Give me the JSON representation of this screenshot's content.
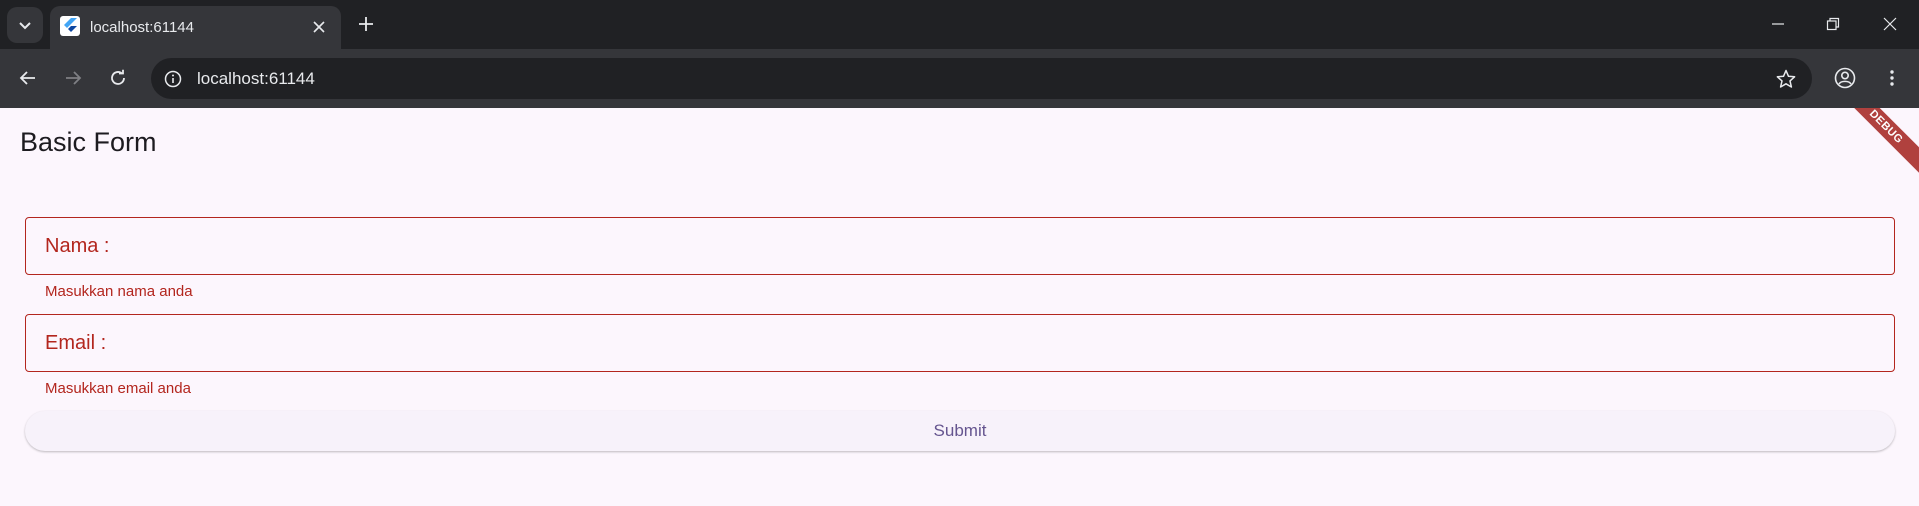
{
  "browser": {
    "tab": {
      "title": "localhost:61144"
    },
    "address_bar": {
      "url": "localhost:61144"
    }
  },
  "app": {
    "title": "Basic Form",
    "debug_banner": "DEBUG",
    "form": {
      "fields": [
        {
          "label": "Nama :",
          "value": "",
          "error": "Masukkan nama anda"
        },
        {
          "label": "Email :",
          "value": "",
          "error": "Masukkan email anda"
        }
      ],
      "submit_label": "Submit"
    }
  },
  "colors": {
    "error": "#b3261e",
    "primary": "#65558f",
    "background": "#fcf6fd",
    "chrome_dark": "#202124",
    "chrome_toolbar": "#35363a"
  },
  "icons": {
    "tab_list": "chevron-down-icon",
    "favicon": "flutter-icon",
    "tab_close": "close-icon",
    "new_tab": "plus-icon",
    "minimize": "minimize-icon",
    "restore": "restore-icon",
    "window_close": "close-icon",
    "back": "arrow-left-icon",
    "forward": "arrow-right-icon",
    "reload": "reload-icon",
    "site_info": "info-icon",
    "bookmark": "star-icon",
    "profile": "account-circle-icon",
    "menu": "kebab-menu-icon"
  }
}
